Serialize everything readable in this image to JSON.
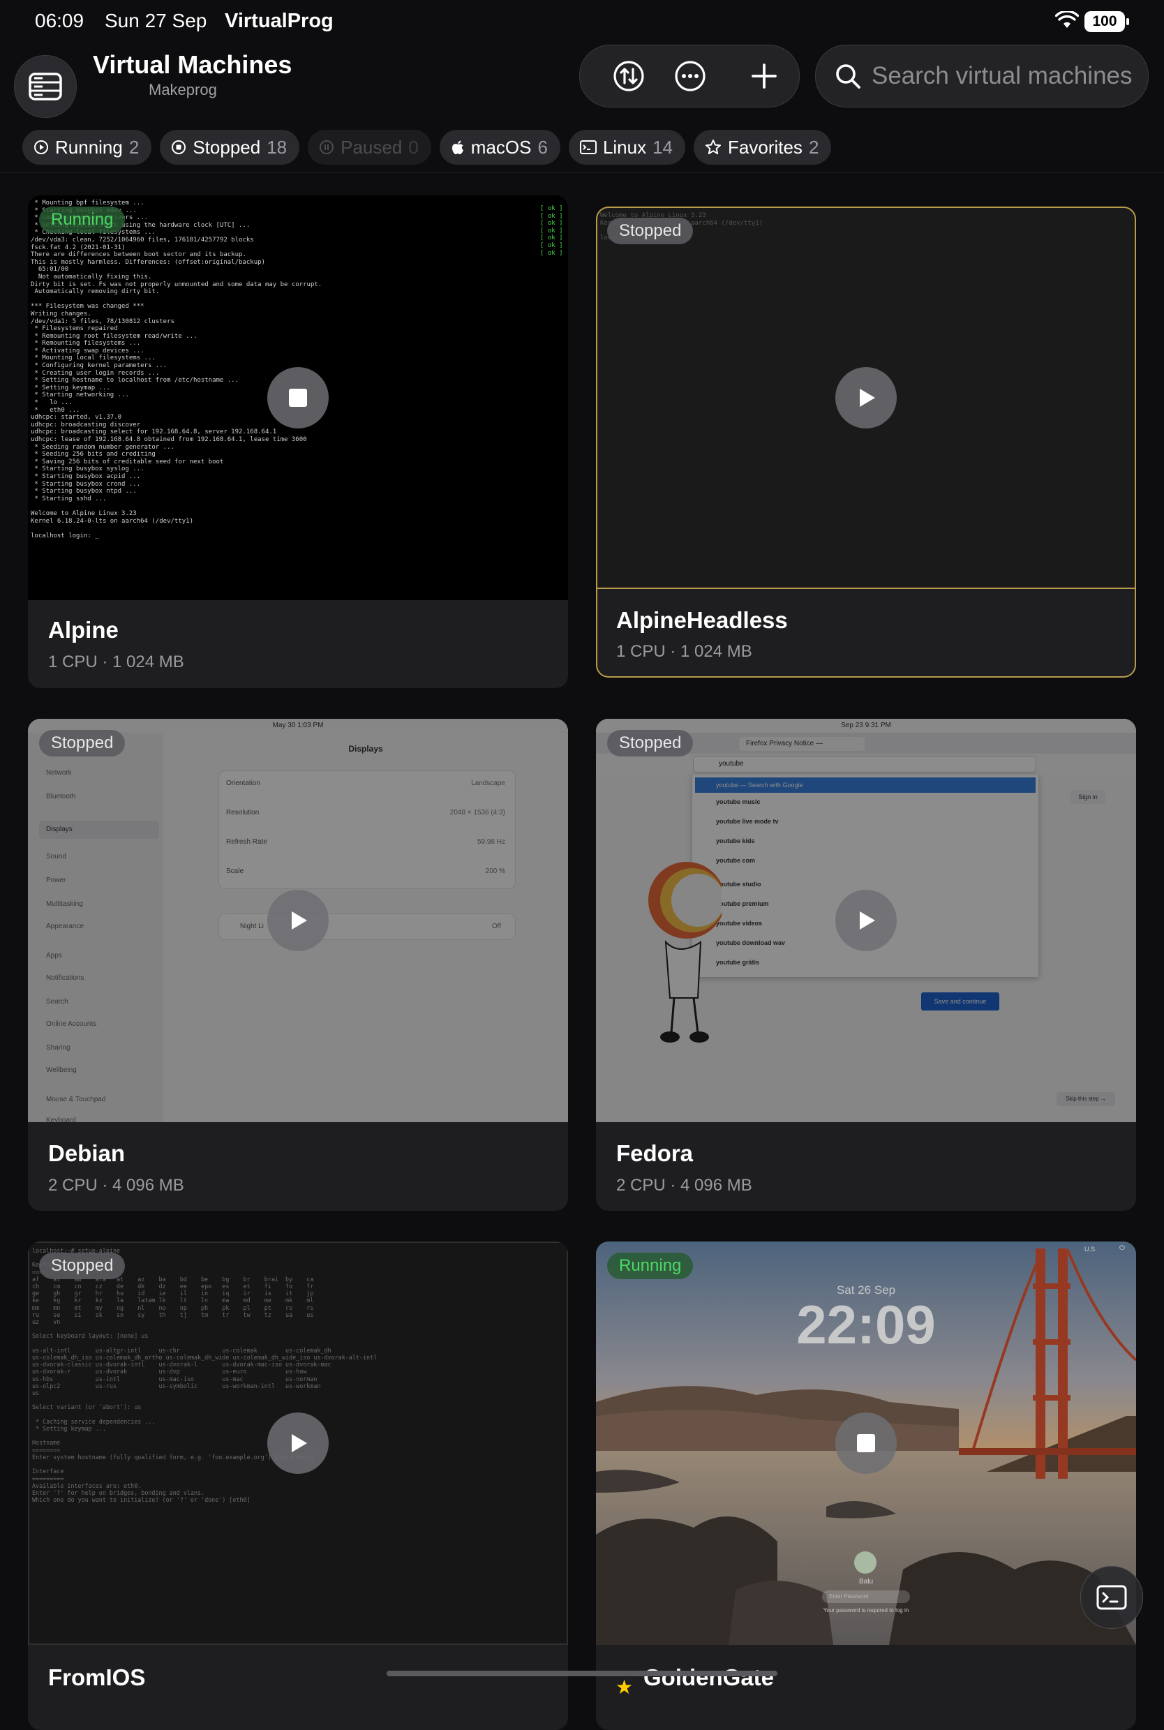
{
  "status_bar": {
    "time": "06:09",
    "date": "Sun 27 Sep",
    "app": "VirtualProg",
    "battery": "100"
  },
  "header": {
    "title": "Virtual Machines",
    "subtitle": "Makeprog"
  },
  "search": {
    "placeholder": "Search virtual machines"
  },
  "filters": [
    {
      "label": "Running",
      "count": "2",
      "icon": "play-circle-icon"
    },
    {
      "label": "Stopped",
      "count": "18",
      "icon": "stop-circle-icon"
    },
    {
      "label": "Paused",
      "count": "0",
      "icon": "pause-circle-icon",
      "disabled": true
    },
    {
      "label": "macOS",
      "count": "6",
      "icon": "apple-icon"
    },
    {
      "label": "Linux",
      "count": "14",
      "icon": "terminal-window-icon"
    },
    {
      "label": "Favorites",
      "count": "2",
      "icon": "star-icon"
    }
  ],
  "vms": [
    {
      "name": "Alpine",
      "specs": "1 CPU · 1 024 MB",
      "status": "Running",
      "action": "stop"
    },
    {
      "name": "AlpineHeadless",
      "specs": "1 CPU · 1 024 MB",
      "status": "Stopped",
      "action": "play"
    },
    {
      "name": "Debian",
      "specs": "2 CPU · 4 096 MB",
      "status": "Stopped",
      "action": "play"
    },
    {
      "name": "Fedora",
      "specs": "2 CPU · 4 096 MB",
      "status": "Stopped",
      "action": "play"
    },
    {
      "name": "FromIOS",
      "status": "Stopped",
      "action": "play"
    },
    {
      "name": "GoldenGate",
      "status": "Running",
      "action": "stop",
      "favorite": true
    }
  ],
  "thumbs": {
    "alpine_terminal": " * Mounting bpf filesystem ...\n * Starting busybox mdev ...\n * Loading hardware drivers ...\n * Setting system clock using the hardware clock [UTC] ...\n * Checking local filesystems ...\n/dev/vda3: clean, 7252/1064960 files, 176181/4257792 blocks\nfsck.fat 4.2 (2021-01-31)\nThere are differences between boot sector and its backup.\nThis is mostly harmless. Differences: (offset:original/backup)\n  65:01/00\n  Not automatically fixing this.\nDirty bit is set. Fs was not properly unmounted and some data may be corrupt.\n Automatically removing dirty bit.\n\n*** Filesystem was changed ***\nWriting changes.\n/dev/vda1: 5 files, 78/130812 clusters\n * Filesystems repaired\n * Remounting root filesystem read/write ...\n * Remounting filesystems ...\n * Activating swap devices ...\n * Mounting local filesystems ...\n * Configuring kernel parameters ...\n * Creating user login records ...\n * Setting hostname to localhost from /etc/hostname ...\n * Setting keymap ...\n * Starting networking ...\n *   lo ...\n *   eth0 ...\nudhcpc: started, v1.37.0\nudhcpc: broadcasting discover\nudhcpc: broadcasting select for 192.168.64.8, server 192.168.64.1\nudhcpc: lease of 192.168.64.8 obtained from 192.168.64.1, lease time 3600\n * Seeding random number generator ...\n * Seeding 256 bits and crediting\n * Saving 256 bits of creditable seed for next boot\n * Starting busybox syslog ...\n * Starting busybox acpid ...\n * Starting busybox crond ...\n * Starting busybox ntpd ...\n * Starting sshd ...\n\nWelcome to Alpine Linux 3.23\nKernel 6.18.24-0-lts on aarch64 (/dev/tty1)\n\nlocalhost login: _",
    "headless_terminal": "Welcome to Alpine Linux 3.23\nKernel 6.18.24-0-lts on aarch64 (/dev/tty1)\n\nlocalhost login: _",
    "debian_clock": "May 30  1:03 PM",
    "debian_window_title": "Displays",
    "debian_sidebar": [
      "Network",
      "Bluetooth",
      "Displays",
      "Sound",
      "Power",
      "Multitasking",
      "Appearance",
      "Apps",
      "Notifications",
      "Search",
      "Online Accounts",
      "Sharing",
      "Wellbeing",
      "Mouse & Touchpad",
      "Keyboard"
    ],
    "debian_rows": [
      {
        "k": "Orientation",
        "v": "Landscape"
      },
      {
        "k": "Resolution",
        "v": "2048 × 1536 (4:3)"
      },
      {
        "k": "Refresh Rate",
        "v": "59.98 Hz"
      },
      {
        "k": "Scale",
        "v": "200 %"
      }
    ],
    "debian_night": "Night Li",
    "debian_night_val": "Off",
    "fedora_clock": "Sep 23  9:31 PM",
    "fedora_tab": "Firefox Privacy Notice —",
    "fedora_url": "youtube",
    "fedora_suggestions": [
      "youtube — Search with Google",
      "youtube music",
      "youtube live mode tv",
      "youtube kids",
      "youtube com",
      "youtube studio",
      "youtube premium",
      "youtube videos",
      "youtube download wav",
      "youtube grátis"
    ],
    "fedora_btn": "Save and continue",
    "fedora_signin": "Sign in",
    "fedora_skip": "Skip this step →",
    "fromios_terminal": "localhost:~# setup-alpine\n\nKeymap\n======\naf    al    am    ara   at    az    ba    bd    be    bg    br    brai  by    ca\nch    cm    cn    cz    de    dk    dz    ee    epo   es    et    fi    fo    fr\nge    gh    gr    hr    hu    id    ie    il    in    iq    ir    is    it    jp\nke    kg    kr    kz    la    latam lk    lt    lv    ma    md    me    mk    ml\nmm    mn    mt    my    ng    nl    no    np    ph    pk    pl    pt    ro    rs\nru    se    si    sk    sn    sy    th    tj    tm    tr    tw    tz    ua    us\nuz    vn\n\nSelect keyboard layout: [none] us\n\nus-alt-intl       us-altgr-intl     us-chr            us-colemak        us-colemak_dh\nus-colemak_dh_iso us-colemak_dh_ortho us-colemak_dh_wide us-colemak_dh_wide_iso us-dvorak-alt-intl\nus-dvorak-classic us-dvorak-intl    us-dvorak-l       us-dvorak-mac-iso us-dvorak-mac\nus-dvorak-r       us-dvorak         us-dvp            us-euro           us-haw\nus-hbs            us-intl           us-mac-iso        us-mac            us-norman\nus-olpc2          us-rus            us-symbolic       us-workman-intl   us-workman\nus\n\nSelect variant (or 'abort'): us\n\n * Caching service dependencies ...\n * Setting keymap ...\n\nHostname\n========\nEnter system hostname (fully qualified form, e.g. 'foo.example.org') [localhost]\n\nInterface\n=========\nAvailable interfaces are: eth0.\nEnter '?' for help on bridges, bonding and vlans.\nWhich one do you want to initialize? (or '?' or 'done') [eth0]",
    "gg_date": "Sat 26 Sep",
    "gg_time": "22:09",
    "gg_user": "Balu",
    "gg_pw_placeholder": "Enter Password",
    "gg_pw_hint": "Your password is required to log in",
    "gg_locale": "U.S."
  },
  "colors": {
    "running": "#4cd964",
    "accent_border": "#b89b4a"
  }
}
